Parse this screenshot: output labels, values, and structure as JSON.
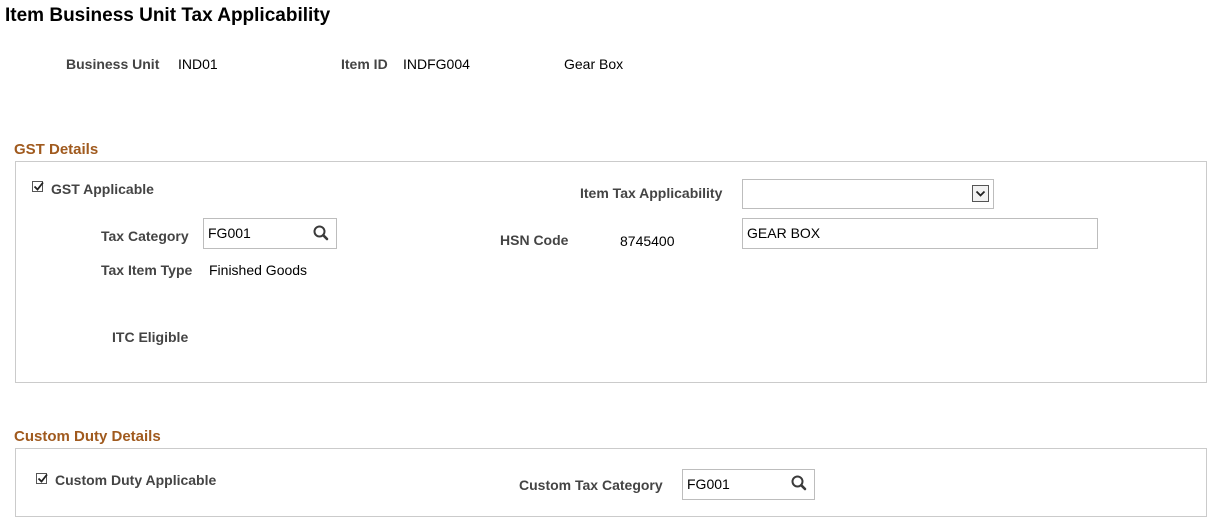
{
  "page": {
    "title": "Item Business Unit Tax Applicability"
  },
  "header": {
    "business_unit_label": "Business Unit",
    "business_unit_value": "IND01",
    "item_id_label": "Item ID",
    "item_id_value": "INDFG004",
    "item_description": "Gear Box"
  },
  "gst": {
    "section_title": "GST Details",
    "applicable_label": "GST Applicable",
    "applicable_checked": true,
    "tax_category_label": "Tax Category",
    "tax_category_value": "FG001",
    "tax_item_type_label": "Tax Item Type",
    "tax_item_type_value": "Finished Goods",
    "itc_eligible_label": "ITC Eligible",
    "item_tax_applicability_label": "Item Tax Applicability",
    "item_tax_applicability_value": "",
    "hsn_code_label": "HSN Code",
    "hsn_code_value": "8745400",
    "hsn_description_value": "GEAR BOX"
  },
  "custom_duty": {
    "section_title": "Custom Duty Details",
    "applicable_label": "Custom Duty Applicable",
    "applicable_checked": true,
    "custom_tax_category_label": "Custom Tax Category",
    "custom_tax_category_value": "FG001"
  },
  "icons": {
    "lookup": "search-icon",
    "dropdown": "chevron-down-icon",
    "checkmark": "checkmark-icon"
  },
  "colors": {
    "section_title": "#a05a1e",
    "label": "#444444",
    "border": "#cbcbcb"
  }
}
